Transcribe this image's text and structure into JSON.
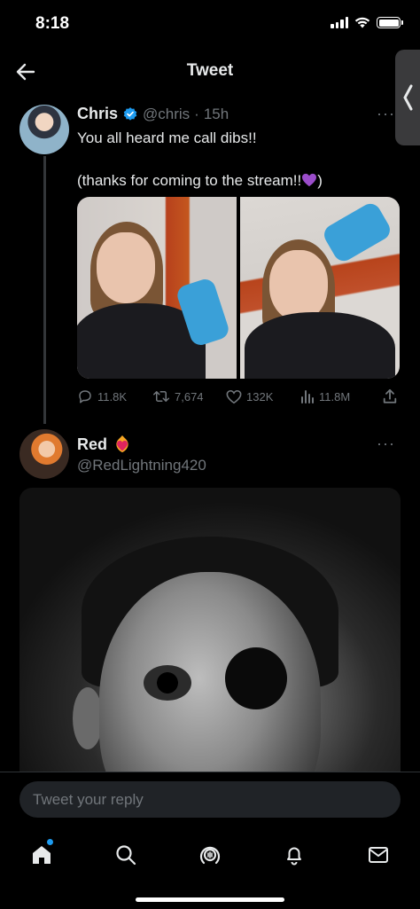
{
  "status_bar": {
    "time": "8:18"
  },
  "header": {
    "title": "Tweet"
  },
  "tweet": {
    "author": {
      "display_name": "Chris",
      "handle": "@chris",
      "verified": true
    },
    "time_separator": "·",
    "time": "15h",
    "text_line1": "You all heard me call dibs!!",
    "text_line2": "(thanks for coming to the stream!!",
    "text_line2_end": ")",
    "emoji": "purple-heart",
    "stats": {
      "replies": "11.8K",
      "retweets": "7,674",
      "likes": "132K",
      "views": "11.8M"
    }
  },
  "reply_tweet": {
    "author": {
      "display_name": "Red",
      "handle": "@RedLightning420",
      "badge_emoji": "heart-on-fire"
    }
  },
  "reply_bar": {
    "placeholder": "Tweet your reply"
  },
  "tab_bar": {
    "items": [
      "home-icon",
      "search-icon",
      "spaces-icon",
      "notifications-icon",
      "messages-icon"
    ],
    "home_has_notification": true
  },
  "colors": {
    "accent": "#1d9bf0",
    "background": "#000000",
    "secondary_text": "#71767b",
    "purple_heart": "#9b4dca"
  }
}
